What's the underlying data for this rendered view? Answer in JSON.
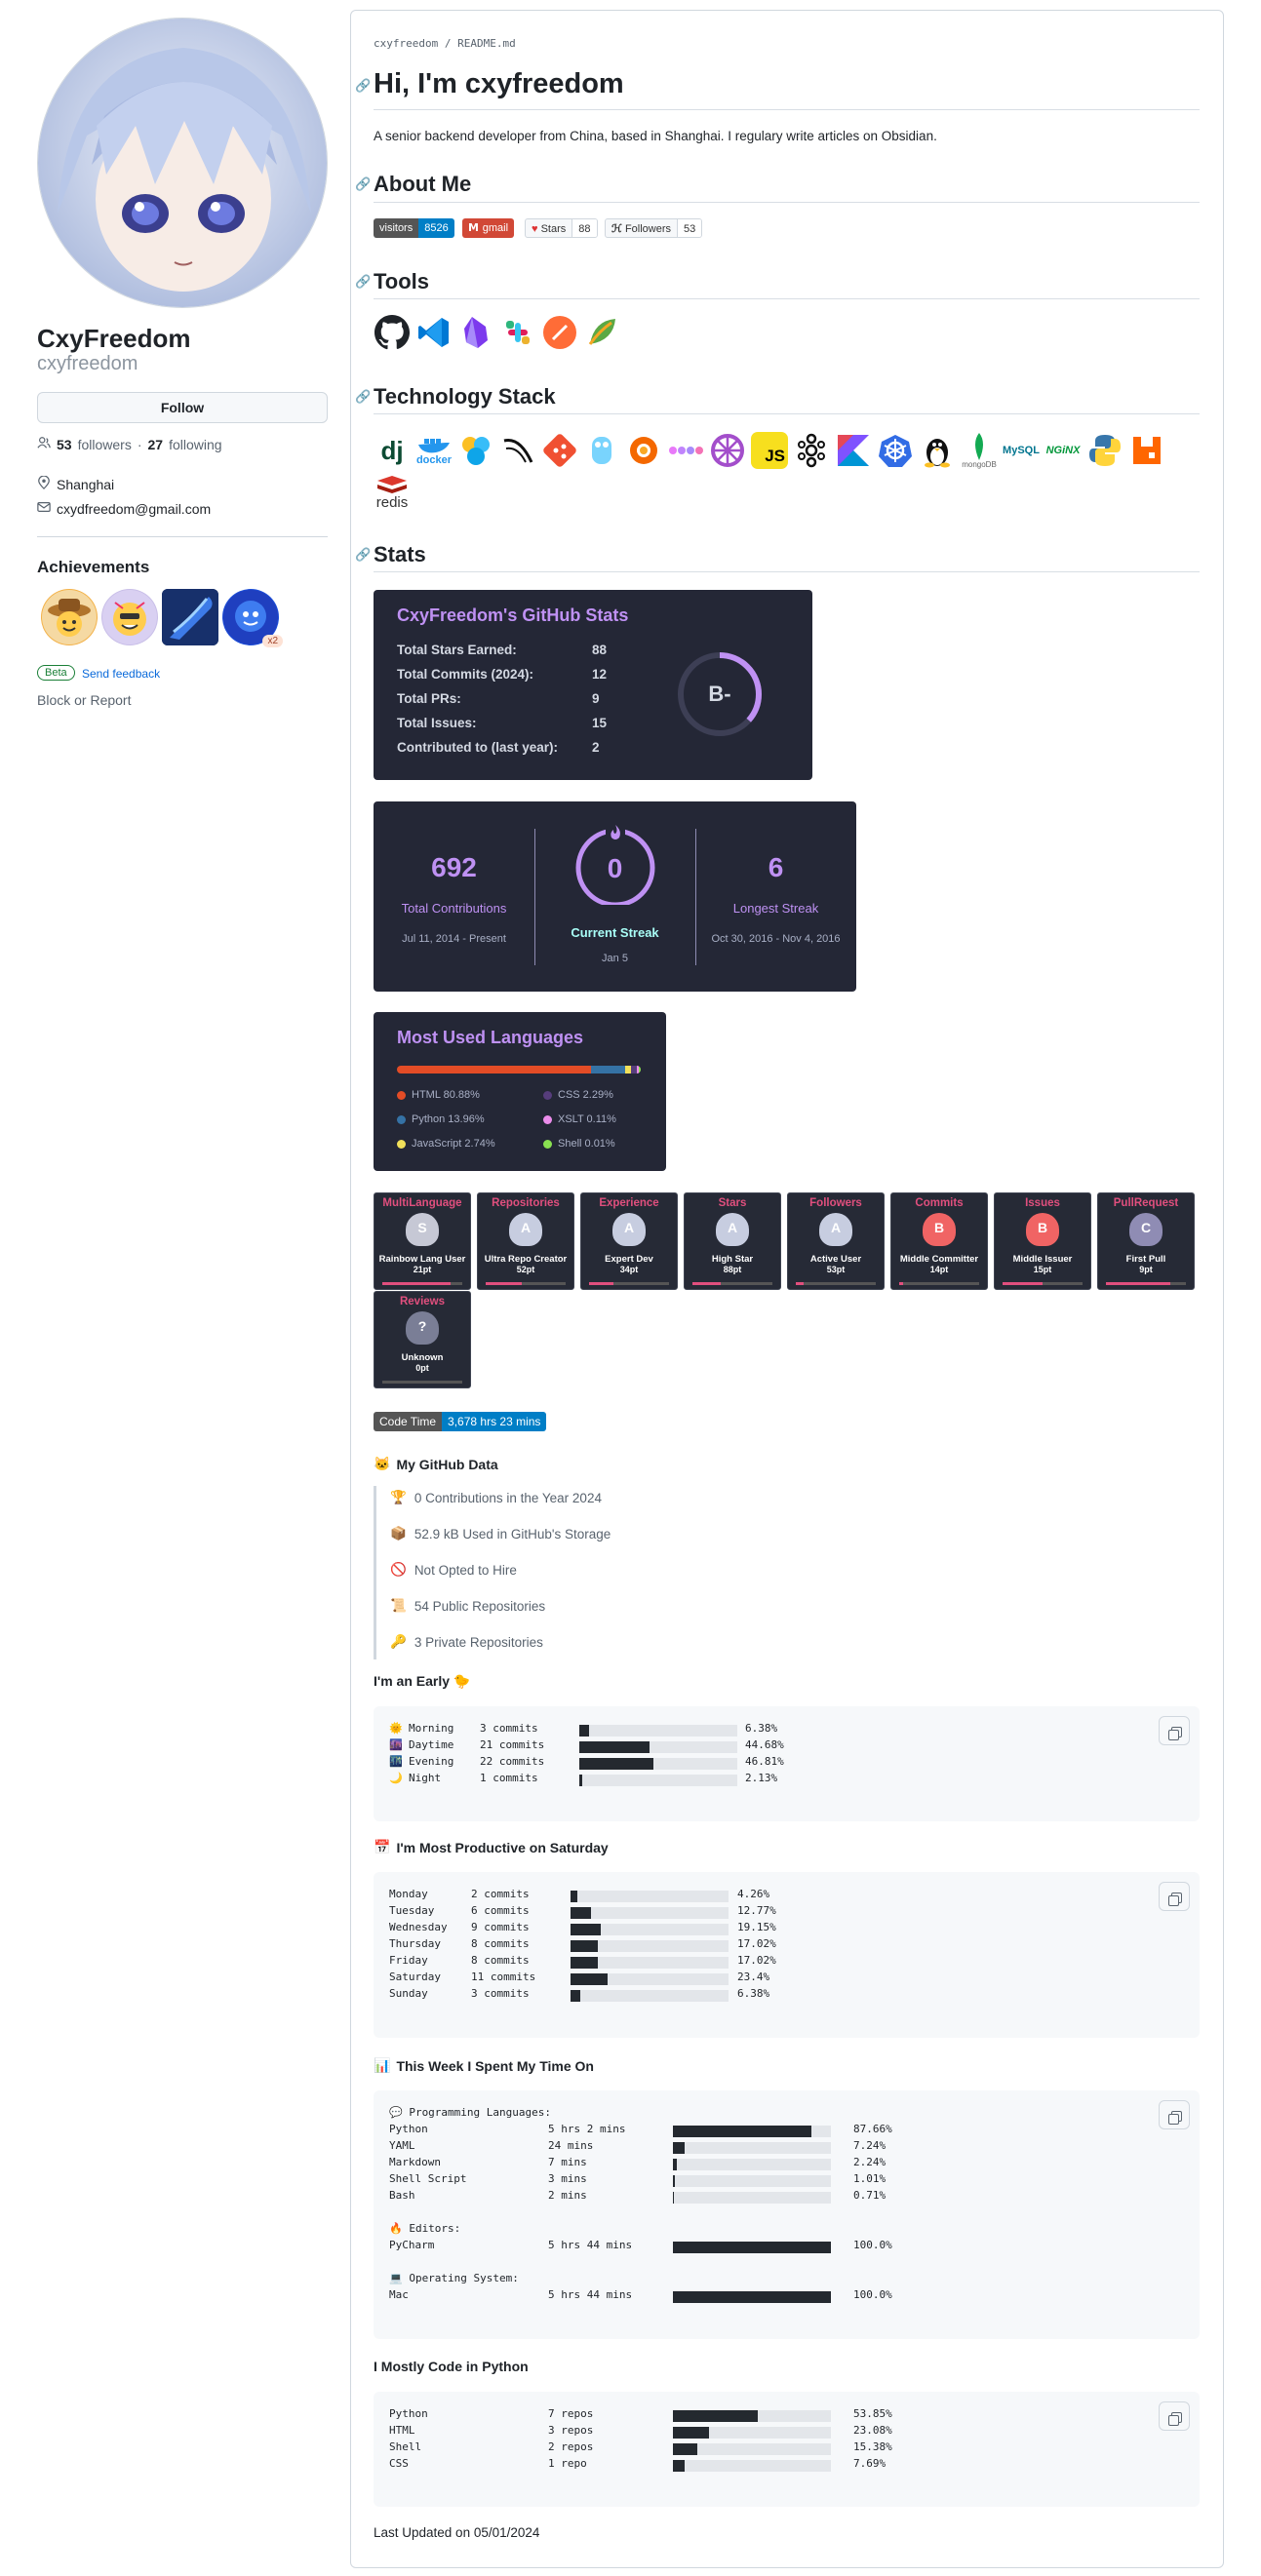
{
  "profile": {
    "display_name": "CxyFreedom",
    "username": "cxyfreedom",
    "follow_label": "Follow",
    "followers": "53",
    "followers_label": "followers",
    "following": "27",
    "following_label": "following",
    "location": "Shanghai",
    "email": "cxydfreedom@gmail.com",
    "achievements_title": "Achievements",
    "achievement_multiplier": "x2",
    "beta_label": "Beta",
    "feedback_label": "Send feedback",
    "block_label": "Block or Report"
  },
  "readme": {
    "path_user": "cxyfreedom",
    "path_sep": " / ",
    "path_file": "README.md",
    "title": "Hi, I'm cxyfreedom",
    "intro": "A senior backend developer from China, based in Shanghai. I regulary write articles on Obsidian.",
    "h_about": "About Me",
    "h_tools": "Tools",
    "h_stack": "Technology Stack",
    "h_stats": "Stats",
    "badges": {
      "visitors_label": "visitors",
      "visitors_value": "8526",
      "gmail_label": "gmail",
      "stars_label": "Stars",
      "stars_value": "88",
      "followers_label": "Followers",
      "followers_value": "53"
    },
    "stack_texts": {
      "dj": "dj",
      "docker": "docker",
      "js": "JS",
      "mongo": "mongoDB",
      "mysql": "MySQL",
      "nginx": "NGiNX",
      "redis": "redis"
    }
  },
  "github_stats": {
    "title": "CxyFreedom's GitHub Stats",
    "rows": [
      {
        "label": "Total Stars Earned:",
        "value": "88"
      },
      {
        "label": "Total Commits (2024):",
        "value": "12"
      },
      {
        "label": "Total PRs:",
        "value": "9"
      },
      {
        "label": "Total Issues:",
        "value": "15"
      },
      {
        "label": "Contributed to (last year):",
        "value": "2"
      }
    ],
    "grade": "B-"
  },
  "streak": {
    "total": "692",
    "total_label": "Total Contributions",
    "total_range": "Jul 11, 2014 - Present",
    "current": "0",
    "current_label": "Current Streak",
    "current_date": "Jan 5",
    "longest": "6",
    "longest_label": "Longest Streak",
    "longest_range": "Oct 30, 2016 - Nov 4, 2016"
  },
  "languages": {
    "title": "Most Used Languages",
    "items": [
      {
        "label": "HTML 80.88%",
        "color": "#e34c26",
        "pct": 80.88
      },
      {
        "label": "CSS 2.29%",
        "color": "#563d7c",
        "pct": 2.29
      },
      {
        "label": "Python 13.96%",
        "color": "#3572a5",
        "pct": 13.96
      },
      {
        "label": "XSLT 0.11%",
        "color": "#eb8ceb",
        "pct": 0.11
      },
      {
        "label": "JavaScript 2.74%",
        "color": "#f1e05a",
        "pct": 2.74
      },
      {
        "label": "Shell 0.01%",
        "color": "#89e051",
        "pct": 0.01
      }
    ]
  },
  "trophies": [
    {
      "title": "MultiLanguage",
      "rank": "S",
      "label": "Rainbow Lang User",
      "pt": "21pt",
      "progress": 0.85
    },
    {
      "title": "Repositories",
      "rank": "A",
      "label": "Ultra Repo Creator",
      "pt": "52pt",
      "progress": 0.45
    },
    {
      "title": "Experience",
      "rank": "A",
      "label": "Expert Dev",
      "pt": "34pt",
      "progress": 0.3
    },
    {
      "title": "Stars",
      "rank": "A",
      "label": "High Star",
      "pt": "88pt",
      "progress": 0.35
    },
    {
      "title": "Followers",
      "rank": "A",
      "label": "Active User",
      "pt": "53pt",
      "progress": 0.1
    },
    {
      "title": "Commits",
      "rank": "B",
      "label": "Middle Committer",
      "pt": "14pt",
      "progress": 0.05
    },
    {
      "title": "Issues",
      "rank": "B",
      "label": "Middle Issuer",
      "pt": "15pt",
      "progress": 0.5
    },
    {
      "title": "PullRequest",
      "rank": "C",
      "label": "First Pull",
      "pt": "9pt",
      "progress": 0.8
    },
    {
      "title": "Reviews",
      "rank": "?",
      "label": "Unknown",
      "pt": "0pt",
      "progress": 0
    }
  ],
  "code_time": {
    "label": "Code Time",
    "value": "3,678 hrs 23 mins"
  },
  "github_data": {
    "title": "My GitHub Data",
    "items": [
      {
        "icon": "🏆",
        "text": "0 Contributions in the Year 2024"
      },
      {
        "icon": "📦",
        "text": "52.9 kB Used in GitHub's Storage"
      },
      {
        "icon": "🚫",
        "text": "Not Opted to Hire"
      },
      {
        "icon": "📜",
        "text": "54 Public Repositories"
      },
      {
        "icon": "🔑",
        "text": "3 Private Repositories"
      }
    ]
  },
  "early": {
    "title": "I'm an Early 🐤",
    "rows": [
      {
        "icon": "🌞",
        "name": "Morning",
        "count": "3 commits",
        "pct": 6.38,
        "pct_text": "6.38%"
      },
      {
        "icon": "🌆",
        "name": "Daytime",
        "count": "21 commits",
        "pct": 44.68,
        "pct_text": "44.68%"
      },
      {
        "icon": "🌃",
        "name": "Evening",
        "count": "22 commits",
        "pct": 46.81,
        "pct_text": "46.81%"
      },
      {
        "icon": "🌙",
        "name": "Night",
        "count": "1 commits",
        "pct": 2.13,
        "pct_text": "2.13%"
      }
    ]
  },
  "productive": {
    "title": "I'm Most Productive on Saturday",
    "icon": "📅",
    "rows": [
      {
        "name": "Monday",
        "count": "2 commits",
        "pct": 4.26,
        "pct_text": "4.26%"
      },
      {
        "name": "Tuesday",
        "count": "6 commits",
        "pct": 12.77,
        "pct_text": "12.77%"
      },
      {
        "name": "Wednesday",
        "count": "9 commits",
        "pct": 19.15,
        "pct_text": "19.15%"
      },
      {
        "name": "Thursday",
        "count": "8 commits",
        "pct": 17.02,
        "pct_text": "17.02%"
      },
      {
        "name": "Friday",
        "count": "8 commits",
        "pct": 17.02,
        "pct_text": "17.02%"
      },
      {
        "name": "Saturday",
        "count": "11 commits",
        "pct": 23.4,
        "pct_text": "23.4%"
      },
      {
        "name": "Sunday",
        "count": "3 commits",
        "pct": 6.38,
        "pct_text": "6.38%"
      }
    ]
  },
  "week": {
    "title": "This Week I Spent My Time On",
    "icon": "📊",
    "groups": [
      {
        "heading": "💬 Programming Languages:",
        "rows": [
          {
            "name": "Python",
            "time": "5 hrs 2 mins",
            "pct": 87.66,
            "pct_text": "87.66%"
          },
          {
            "name": "YAML",
            "time": "24 mins",
            "pct": 7.24,
            "pct_text": "7.24%"
          },
          {
            "name": "Markdown",
            "time": "7 mins",
            "pct": 2.24,
            "pct_text": "2.24%"
          },
          {
            "name": "Shell Script",
            "time": "3 mins",
            "pct": 1.01,
            "pct_text": "1.01%"
          },
          {
            "name": "Bash",
            "time": "2 mins",
            "pct": 0.71,
            "pct_text": "0.71%"
          }
        ]
      },
      {
        "heading": "🔥 Editors:",
        "rows": [
          {
            "name": "PyCharm",
            "time": "5 hrs 44 mins",
            "pct": 100,
            "pct_text": "100.0%"
          }
        ]
      },
      {
        "heading": "💻 Operating System:",
        "rows": [
          {
            "name": "Mac",
            "time": "5 hrs 44 mins",
            "pct": 100,
            "pct_text": "100.0%"
          }
        ]
      }
    ]
  },
  "python": {
    "title": "I Mostly Code in Python",
    "rows": [
      {
        "name": "Python",
        "count": "7 repos",
        "pct": 53.85,
        "pct_text": "53.85%"
      },
      {
        "name": "HTML",
        "count": "3 repos",
        "pct": 23.08,
        "pct_text": "23.08%"
      },
      {
        "name": "Shell",
        "count": "2 repos",
        "pct": 15.38,
        "pct_text": "15.38%"
      },
      {
        "name": "CSS",
        "count": "1 repo",
        "pct": 7.69,
        "pct_text": "7.69%"
      }
    ]
  },
  "footer": "Last Updated on 05/01/2024"
}
